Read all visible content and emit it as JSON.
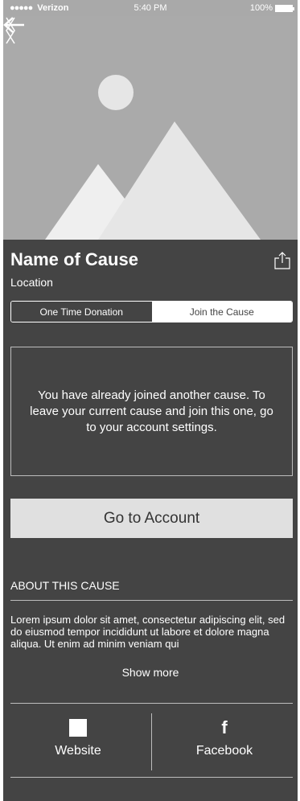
{
  "status_bar": {
    "signal": "●●●●●",
    "carrier": "Verizon",
    "time": "5:40 PM",
    "battery": "100%"
  },
  "hero": {
    "back_icon": "arrow-left-icon",
    "prev_icon": "chevron-left-icon",
    "next_icon": "chevron-right-icon",
    "image_icon": "image-placeholder-icon"
  },
  "cause": {
    "name": "Name of Cause",
    "location": "Location",
    "share_icon": "share-icon"
  },
  "tabs": [
    {
      "label": "One Time Donation",
      "selected": false
    },
    {
      "label": "Join the Cause",
      "selected": true
    }
  ],
  "notice": {
    "message": "You have already joined another cause. To leave your current cause and join this one, go to your account settings."
  },
  "actions": {
    "go_to_account": "Go to Account"
  },
  "about": {
    "heading": "ABOUT THIS CAUSE",
    "text": "Lorem ipsum dolor sit amet, consectetur adipiscing elit, sed do eiusmod tempor incididunt ut labore et dolore magna aliqua. Ut enim ad minim veniam qui",
    "show_more": "Show more"
  },
  "links": [
    {
      "label": "Website",
      "icon": "website-icon"
    },
    {
      "label": "Facebook",
      "icon": "facebook-icon",
      "glyph": "f"
    }
  ],
  "colors": {
    "panel_bg": "#444444",
    "hero_bg": "#aaaaaa",
    "button_bg": "#e0e0e0",
    "accent_text": "#ffffff"
  }
}
